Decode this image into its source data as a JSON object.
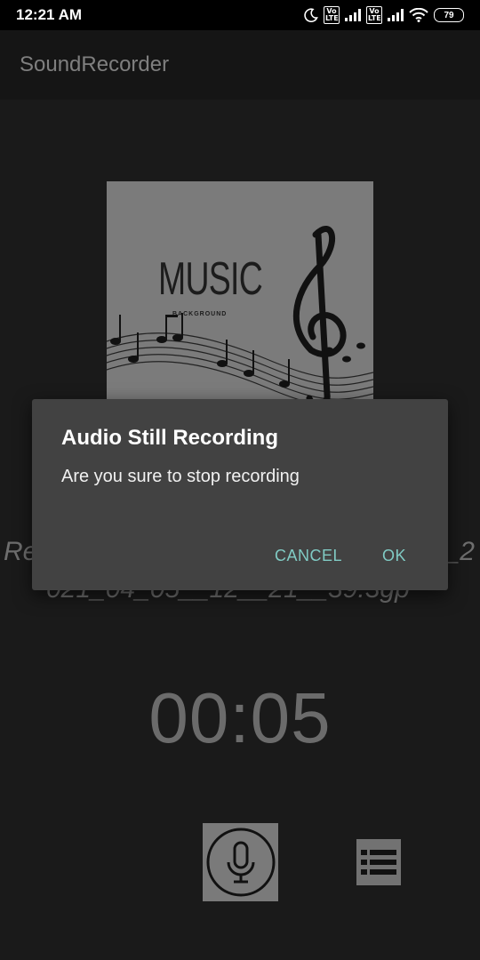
{
  "status_bar": {
    "time": "12:21 AM",
    "volte_1": "Vo LTE",
    "volte_2": "Vo LTE",
    "battery": "79",
    "icons": [
      "moon-icon",
      "signal-icon",
      "signal-icon",
      "wifi-icon",
      "battery-icon"
    ]
  },
  "appbar": {
    "title": "SoundRecorder"
  },
  "cover": {
    "music_text": "MUSIC",
    "background_text": "BACKGROUND"
  },
  "recording": {
    "filename_line1_start": "Re",
    "filename_line1_end": "_2",
    "filename_line2": "021_04_05__12__21__39.3gp",
    "timer": "00:05"
  },
  "controls": {
    "mic_icon": "microphone-icon",
    "list_icon": "list-icon"
  },
  "dialog": {
    "title": "Audio Still Recording",
    "message": "Are you sure to stop recording",
    "cancel_label": "CANCEL",
    "ok_label": "OK",
    "accent_color": "#80cbc4"
  }
}
